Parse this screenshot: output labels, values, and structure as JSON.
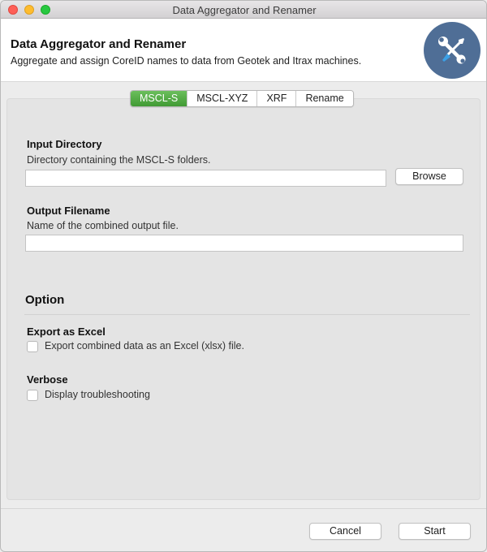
{
  "window": {
    "title": "Data Aggregator and Renamer"
  },
  "header": {
    "title": "Data Aggregator and Renamer",
    "subtitle": "Aggregate and assign CoreID names to data from Geotek and Itrax machines.",
    "logo_icon": "wrench-screwdriver-icon",
    "logo_color": "#4f6e96"
  },
  "tabs": [
    {
      "label": "MSCL-S",
      "active": true
    },
    {
      "label": "MSCL-XYZ",
      "active": false
    },
    {
      "label": "XRF",
      "active": false
    },
    {
      "label": "Rename",
      "active": false
    }
  ],
  "input_directory": {
    "label": "Input Directory",
    "description": "Directory containing the MSCL-S folders.",
    "value": "",
    "browse_label": "Browse"
  },
  "output_filename": {
    "label": "Output Filename",
    "description": "Name of the combined output file.",
    "value": ""
  },
  "options": {
    "title": "Option",
    "export_excel": {
      "label": "Export as Excel",
      "checkbox_label": "Export combined data as an Excel (xlsx) file.",
      "checked": false
    },
    "verbose": {
      "label": "Verbose",
      "checkbox_label": "Display troubleshooting",
      "checked": false
    }
  },
  "footer": {
    "cancel_label": "Cancel",
    "start_label": "Start"
  },
  "colors": {
    "active_tab": "#4ea840",
    "logo_bg": "#4f6e96"
  }
}
